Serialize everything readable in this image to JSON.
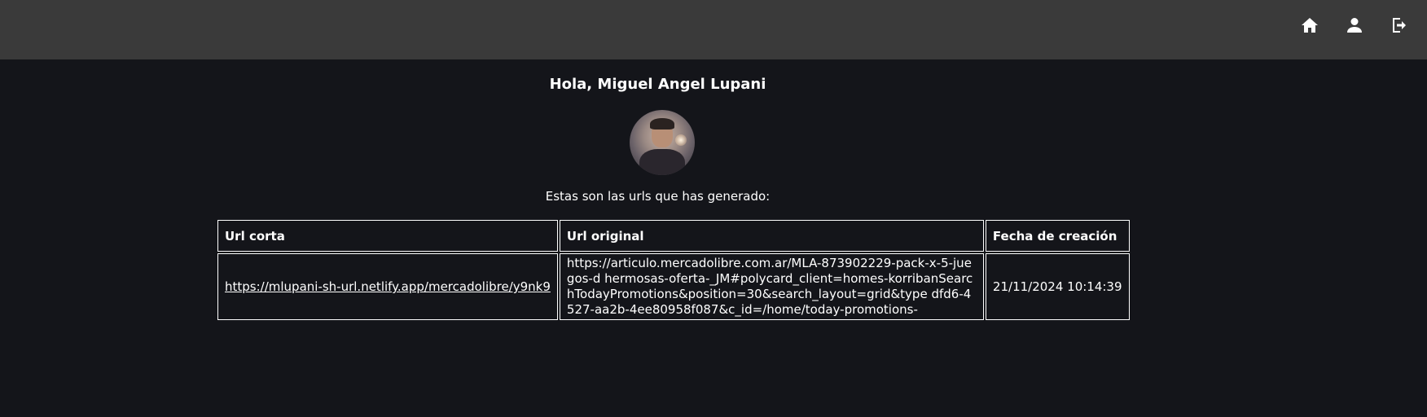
{
  "header": {
    "icons": [
      "home-icon",
      "user-icon",
      "logout-icon"
    ]
  },
  "profile": {
    "greeting": "Hola, Miguel Angel Lupani",
    "subtitle": "Estas son las urls que has generado:"
  },
  "table": {
    "columns": [
      "Url corta",
      "Url original",
      "Fecha de creación"
    ],
    "rows": [
      {
        "short_url": "https://mlupani-sh-url.netlify.app/mercadolibre/y9nk9",
        "original_url": "https://articulo.mercadolibre.com.ar/MLA-873902229-pack-x-5-juegos-d hermosas-oferta-_JM#polycard_client=homes-korribanSearchTodayPromotions&position=30&search_layout=grid&type dfd6-4527-aa2b-4ee80958f087&c_id=/home/today-promotions-",
        "created_at": "21/11/2024 10:14:39"
      }
    ]
  }
}
